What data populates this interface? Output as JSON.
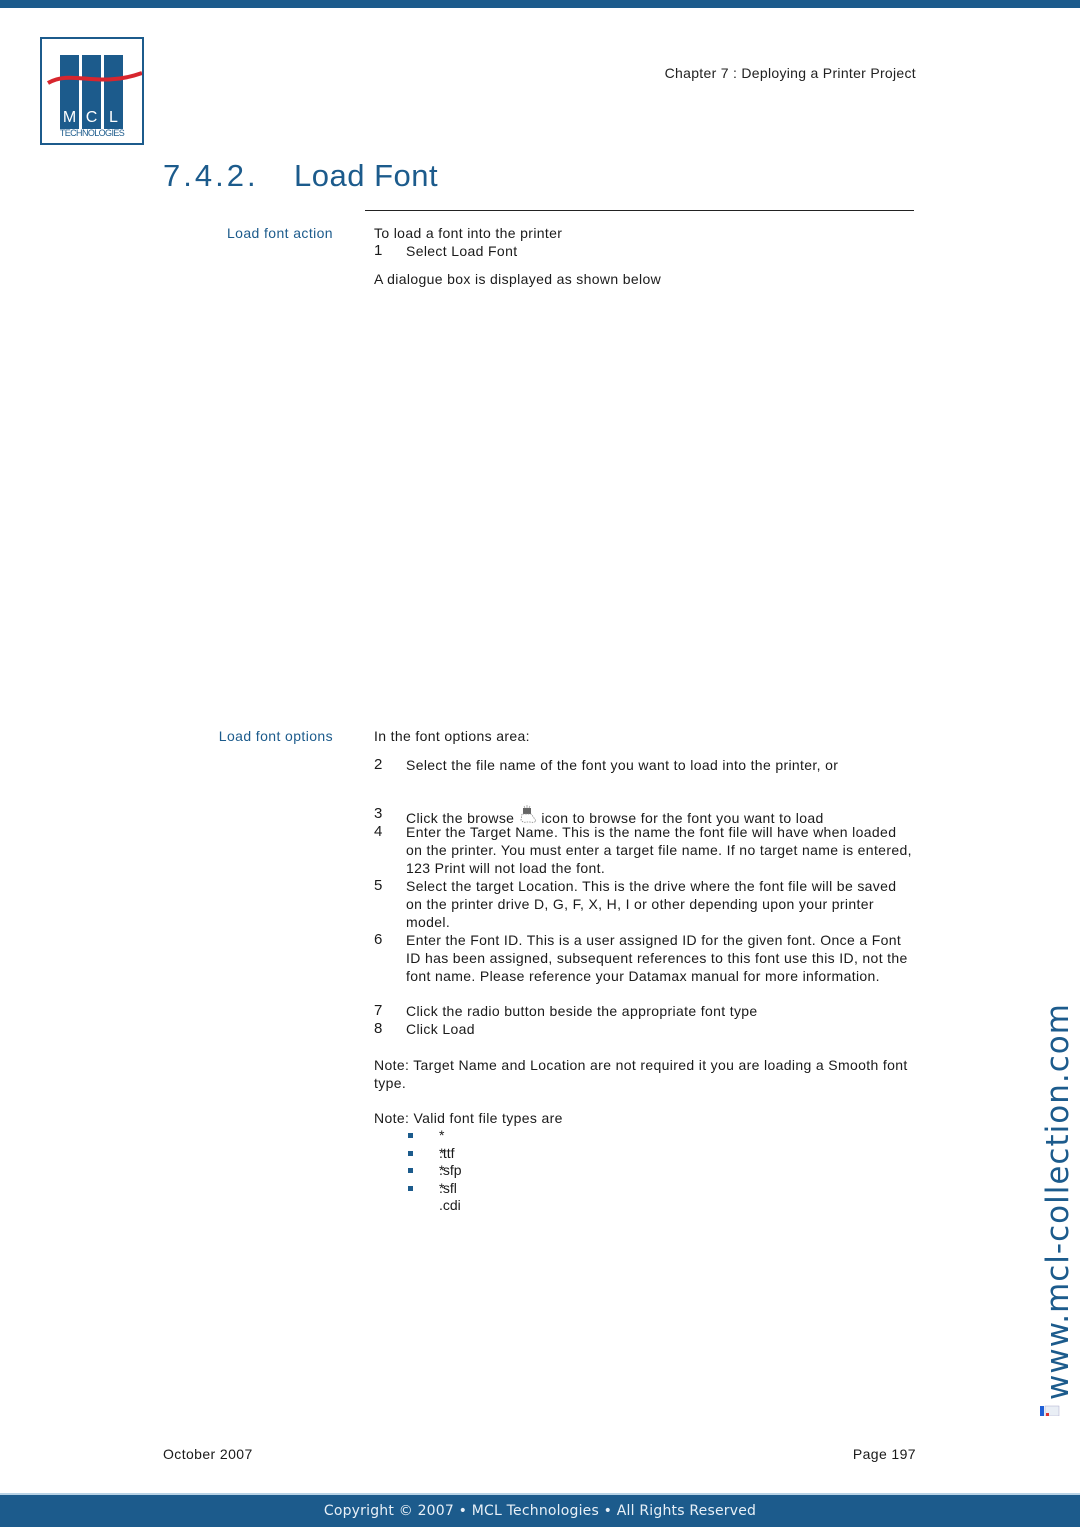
{
  "header": {
    "logo": {
      "letters": [
        "M",
        "C",
        "L"
      ],
      "subtitle": "TECHNOLOGIES"
    },
    "chapter": "Chapter 7 : Deploying a Printer Project"
  },
  "section": {
    "number": "7.4.2.",
    "title": "Load Font"
  },
  "load_font_action": {
    "label": "Load font action",
    "intro": "To load a font into the printer",
    "steps": [
      {
        "n": "1",
        "text": "Select Load Font"
      }
    ],
    "after": "A dialogue box is displayed as shown below"
  },
  "load_font_options": {
    "label": "Load font options",
    "intro": "In the font options area:",
    "steps": [
      {
        "n": "2",
        "text": "Select the file name of the font you want to load into the printer, or"
      },
      {
        "n": "3",
        "text_before": "Click the browse",
        "icon": "browse-folder-icon",
        "text_after": "icon to browse for the font you want to load"
      },
      {
        "n": "4",
        "text": "Enter the Target Name. This is the name the font file will have when loaded on the printer. You must enter a target file name. If no target name is entered, 123 Print will not load the font."
      },
      {
        "n": "5",
        "text": "Select the target Location. This is the drive where the font file will be saved on the printer drive D, G, F, X, H, I or other depending upon your printer model."
      },
      {
        "n": "6",
        "text": "Enter the Font ID. This is a user assigned ID for the given font. Once a Font ID has been assigned, subsequent references to this font use this ID, not the font name. Please reference your Datamax manual for more information."
      },
      {
        "n": "7",
        "text": "Click the radio button beside the appropriate font type"
      },
      {
        "n": "8",
        "text": "Click Load"
      }
    ],
    "note1": "Note: Target Name and Location are not required it you are loading a Smooth font type.",
    "note2": "Note: Valid font file types are",
    "file_types": [
      "* .ttf",
      "* .sfp",
      "* .sfl",
      "* .cdi"
    ]
  },
  "watermark": "www.mcl-collection.com",
  "footer": {
    "date": "October 2007",
    "page": "Page 197",
    "copyright": "Copyright © 2007 • MCL Technologies • All Rights Reserved"
  },
  "colors": {
    "brand_blue": "#1c5b8c",
    "logo_red": "#d7262e",
    "text": "#1a1a1a"
  }
}
